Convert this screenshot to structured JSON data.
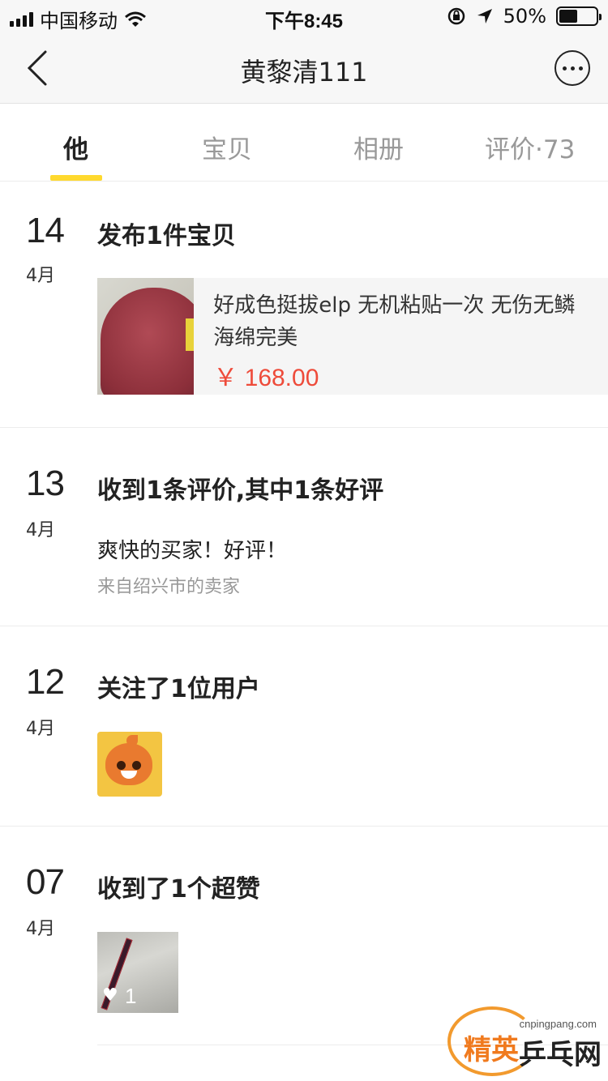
{
  "status_bar": {
    "carrier": "中国移动",
    "time": "下午8:45",
    "battery_percent": "50%",
    "battery_level": 0.5,
    "icons": [
      "signal-icon",
      "wifi-icon",
      "rotation-lock-icon",
      "location-arrow-icon",
      "battery-icon"
    ]
  },
  "nav": {
    "title": "黄黎清111",
    "back_icon": "chevron-left-icon",
    "more_icon": "more-dots-icon"
  },
  "tabs": [
    {
      "label": "他",
      "active": true
    },
    {
      "label": "宝贝",
      "active": false
    },
    {
      "label": "相册",
      "active": false
    },
    {
      "label": "评价·73",
      "active": false
    }
  ],
  "feed": [
    {
      "day": "14",
      "month": "4月",
      "headline": "发布1件宝贝",
      "item": {
        "title": "好成色挺拔elp 无机粘贴一次 无伤无鳞 海绵完美",
        "price": "￥ 168.00"
      }
    },
    {
      "day": "13",
      "month": "4月",
      "headline": "收到1条评价,其中1条好评",
      "review": {
        "text": "爽快的买家！好评！",
        "source": "来自绍兴市的卖家"
      }
    },
    {
      "day": "12",
      "month": "4月",
      "headline": "关注了1位用户"
    },
    {
      "day": "07",
      "month": "4月",
      "headline": "收到了1个超赞",
      "like_count": "1"
    }
  ],
  "watermark": {
    "url": "cnpingpang.com",
    "brand_left": "精英",
    "brand_right": "乒乓网"
  },
  "colors": {
    "accent_yellow": "#ffd92e",
    "price_red": "#ee4b3a"
  }
}
